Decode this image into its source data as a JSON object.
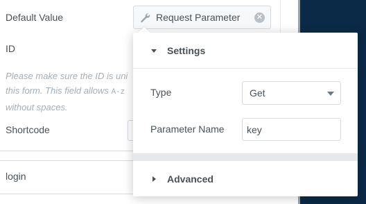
{
  "panel": {
    "default_value_label": "Default Value",
    "default_value_control": {
      "icon": "wrench-icon",
      "text": "Request Parameter",
      "clear_icon": "close-circle-icon"
    },
    "id_label": "ID",
    "note": {
      "line1": "Please make sure the ID is uni",
      "line2_pre": "this form. This field allows ",
      "line2_code": "A-z",
      "line3": "without spaces."
    },
    "shortcode_label": "Shortcode",
    "login_label": "login"
  },
  "popover": {
    "settings_heading": "Settings",
    "type_label": "Type",
    "type_value": "Get",
    "param_name_label": "Parameter Name",
    "param_name_value": "key",
    "advanced_heading": "Advanced"
  },
  "colors": {
    "sidebar_dark": "#0b2a47",
    "text": "#495157",
    "muted": "#a4afb7",
    "border": "#d5dadf"
  }
}
